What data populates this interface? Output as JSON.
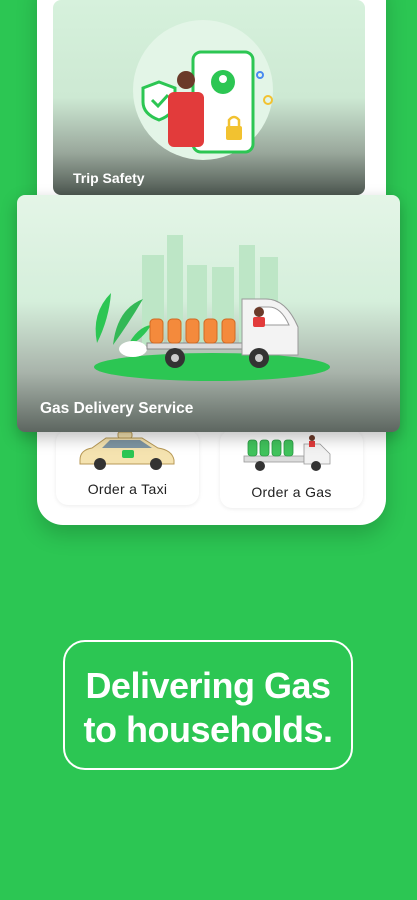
{
  "colors": {
    "background": "#2cc653",
    "accent": "#2cc653",
    "card_overlay": "#4d5750"
  },
  "cards": [
    {
      "label": "Trip Safety",
      "illustration": "person-phone-shield-icon"
    },
    {
      "label": "Gas Delivery Service",
      "illustration": "gas-truck-icon"
    }
  ],
  "services": [
    {
      "label": "Order a Taxi",
      "icon": "taxi-icon"
    },
    {
      "label": "Order a Gas",
      "icon": "gas-truck-icon"
    }
  ],
  "tagline": {
    "line1": "Delivering Gas",
    "line2": "to households."
  }
}
